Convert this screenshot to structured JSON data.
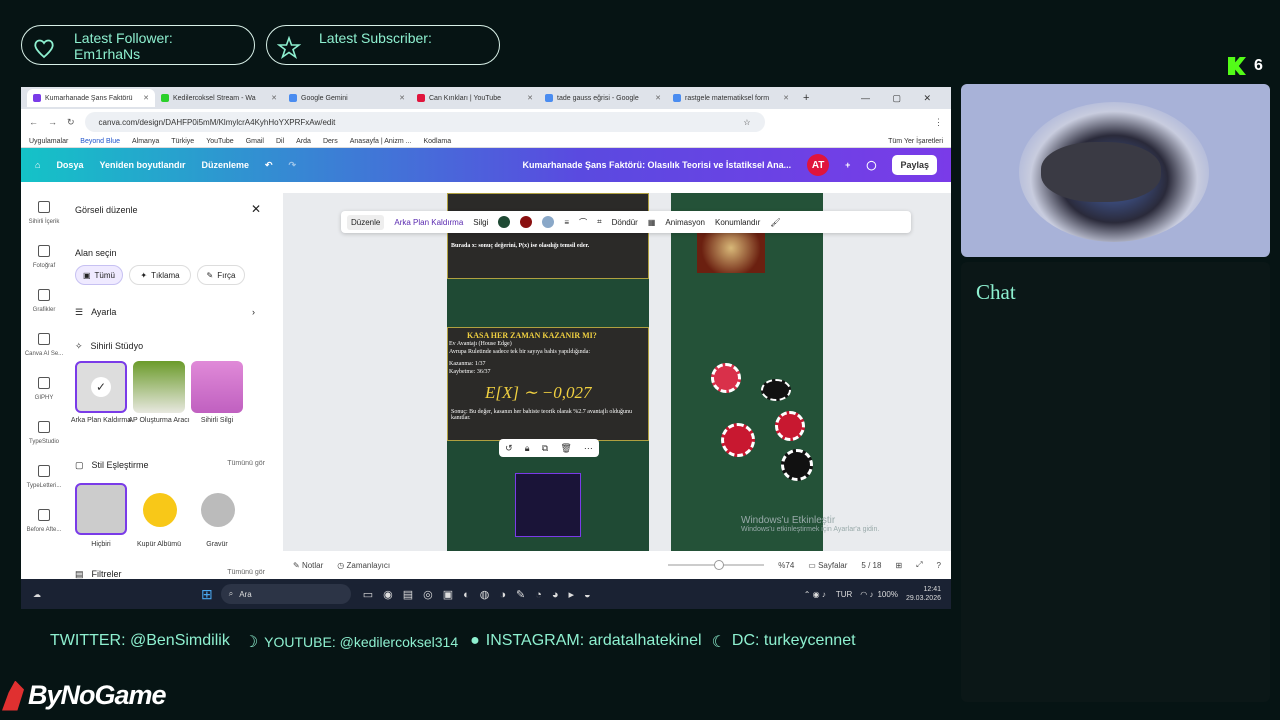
{
  "overlay": {
    "follower_label": "Latest Follower:",
    "follower_name": "Em1rhaNs",
    "subscriber_label": "Latest Subscriber:",
    "subscriber_name": "",
    "kick_count": "6",
    "brand": "ByNoGame",
    "chat_label": "Chat",
    "socials": {
      "twitter": "TWITTER: @BenSimdilik",
      "youtube": "YOUTUBE: @kedilercoksel314",
      "instagram": "INSTAGRAM: ardatalhatekinel",
      "discord": "DC: turkeycennet"
    },
    "colors": {
      "accent": "#8ef0d0",
      "background": "#061414"
    }
  },
  "browser": {
    "tabs": [
      {
        "label": "Kumarhanade Şans Faktörü",
        "active": true,
        "color": "#7a3be8"
      },
      {
        "label": "Kedilercoksel Stream - Wa",
        "active": false,
        "color": "#2bd02b"
      },
      {
        "label": "Google Gemini",
        "active": false,
        "color": "#4a8cf0"
      },
      {
        "label": "Can Kırıkları | YouTube",
        "active": false,
        "color": "#e0143c"
      },
      {
        "label": "tade gauss eğrisi - Google",
        "active": false,
        "color": "#4a8cf0"
      },
      {
        "label": "rastgele matematiksel form",
        "active": false,
        "color": "#4a8cf0"
      }
    ],
    "url": "canva.com/design/DAHFP0i5mM/KlmylcrA4KyhHoYXPRFxAw/edit",
    "bookmarks": [
      "Uygulamalar",
      "Beyond Blue",
      "Almanya",
      "Türkiye",
      "YouTube",
      "Gmail",
      "Dil",
      "Arda",
      "Ders",
      "Anasayfa | Anizm ...",
      "Kodlama",
      "Tüm Yer İşaretleri"
    ]
  },
  "canva": {
    "menu": [
      "Dosya",
      "Yeniden boyutlandır",
      "Düzenleme"
    ],
    "doc_title": "Kumarhanade Şans Faktörü: Olasılık Teorisi ve İstatiksel Ana...",
    "avatar": "AT",
    "share": "Paylaş",
    "rail": [
      "Sihirli İçerik",
      "Fotoğraf",
      "Grafikler",
      "Canva AI Se...",
      "GIPHY",
      "TypeStudio",
      "TypeLetteri...",
      "Before Afte..."
    ],
    "panel": {
      "title": "Görseli düzenle",
      "select_area": "Alan seçin",
      "chips": [
        "Tümü",
        "Tıklama",
        "Fırça"
      ],
      "adjust": "Ayarla",
      "magic_studio": "Sihirli Stüdyo",
      "magic_items": [
        "Arka Plan Kaldırma",
        "AP Oluşturma Aracı",
        "Sihirli Silgi"
      ],
      "style_match": "Stil Eşleştirme",
      "see_all": "Tümünü gör",
      "style_items": [
        "Hiçbiri",
        "Kupür Albümü",
        "Gravür"
      ],
      "filters": "Filtreler",
      "see_all2": "Tümünü gör"
    },
    "context_toolbar": [
      "Düzenle",
      "Arka Plan Kaldırma",
      "Silgi",
      "Döndür",
      "Animasyon",
      "Konumlandır"
    ],
    "slide": {
      "top_text": "Burada x: sonuç değerini, P(x) ise olasılığı temsil eder.",
      "box_title": "KASA HER ZAMAN KAZANIR MI?",
      "box_sub": "Ev Avantajı (House Edge)",
      "box_line": "Avrupa Ruletinde sadece tek bir sayıya bahis yapıldığında:",
      "win": "Kazanma: 1/37",
      "lose": "Kaybetme: 36/37",
      "formula": "E[X] ∼ −0,027",
      "result": "Sonuç: Bu değer, kasanın her bahiste teorik olarak %2.7 avantajlı olduğunu kanıtlar."
    },
    "watermark1": "Windows'u Etkinleştir",
    "watermark2": "Windows'u etkinleştirmek için Ayarlar'a gidin.",
    "footer": {
      "notes": "Notlar",
      "timer": "Zamanlayıcı",
      "zoom": "%74",
      "pages_label": "Sayfalar",
      "page_count": "5 / 18"
    }
  },
  "taskbar": {
    "search": "Ara",
    "lang": "TUR",
    "battery": "100%",
    "time": "12:41",
    "date": "29.03.2026"
  }
}
